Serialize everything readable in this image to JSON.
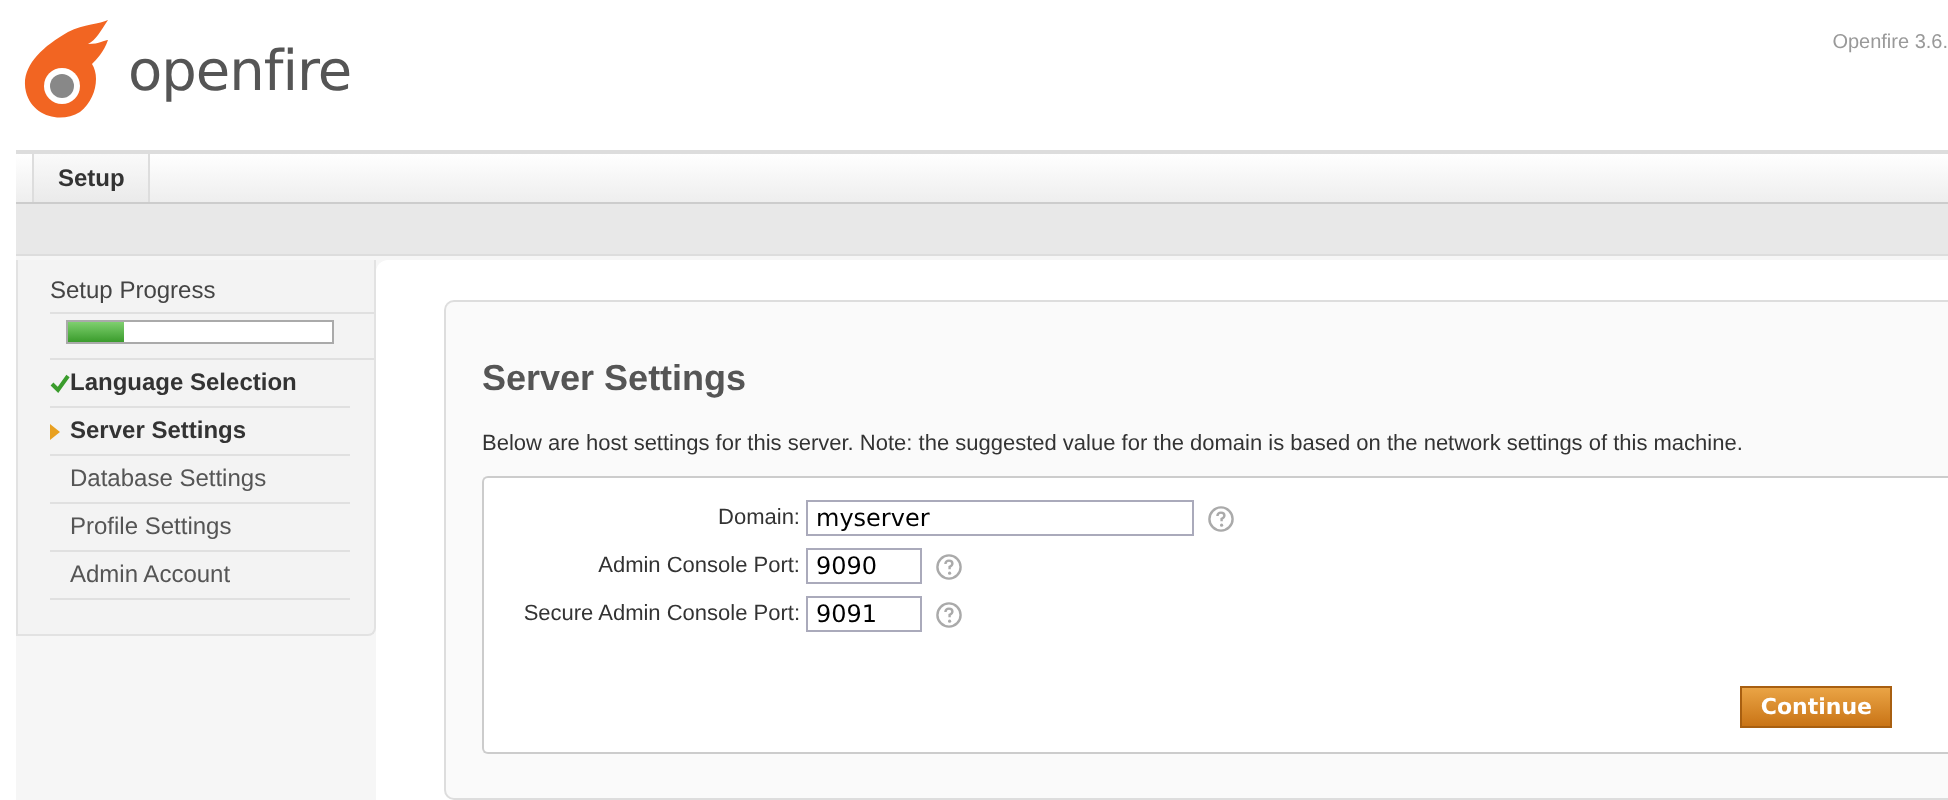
{
  "header": {
    "logo_text": "openfire",
    "version": "Openfire 3.6."
  },
  "tabs": [
    {
      "label": "Setup",
      "selected": true
    }
  ],
  "sidebar": {
    "title": "Setup Progress",
    "progress": {
      "level": 0.21
    },
    "items": [
      {
        "label": "Language Selection",
        "kind": "done"
      },
      {
        "label": "Server Settings",
        "kind": "current"
      },
      {
        "label": "Database Settings",
        "kind": "pending"
      },
      {
        "label": "Profile Settings",
        "kind": "pending"
      },
      {
        "label": "Admin Account",
        "kind": "pending"
      }
    ]
  },
  "main": {
    "title": "Server Settings",
    "description": "Below are host settings for this server. Note: the suggested value for the domain is based on the network settings of this machine.",
    "fields": [
      {
        "label": "Domain:",
        "value": "myserver",
        "kind": "wide"
      },
      {
        "label": "Admin Console Port:",
        "value": "9090",
        "kind": "narrow"
      },
      {
        "label": "Secure Admin Console Port:",
        "value": "9091",
        "kind": "narrow"
      }
    ],
    "button": "Continue"
  }
}
